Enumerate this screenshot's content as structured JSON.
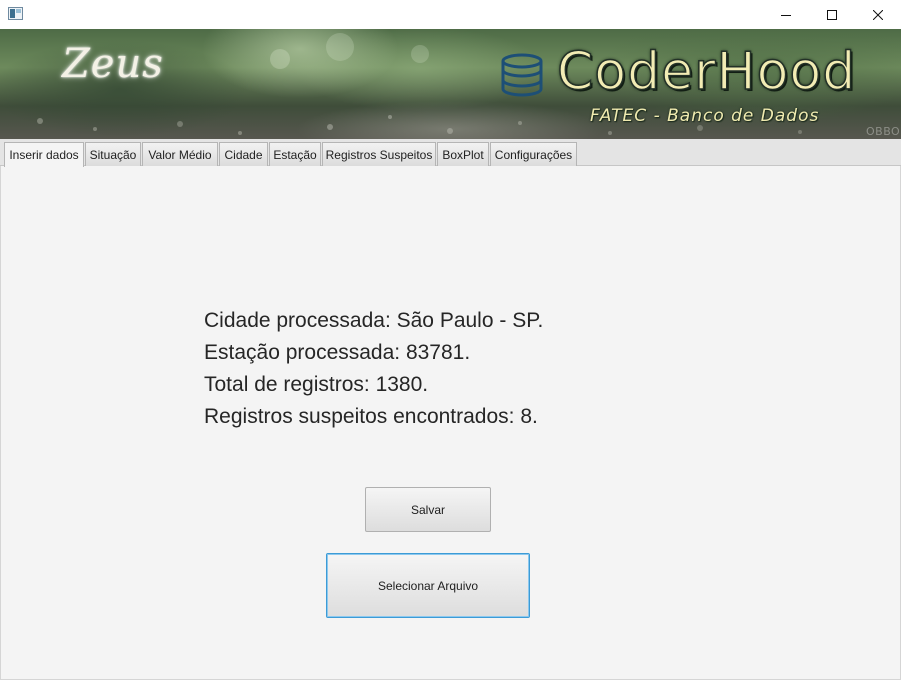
{
  "window": {
    "icons": {
      "app": "app-window-icon",
      "minimize": "minimize-icon",
      "maximize": "maximize-icon",
      "close": "close-icon"
    }
  },
  "banner": {
    "left_logo": "Zeus",
    "title": "CoderHood",
    "subtitle": "FATEC - Banco de Dados",
    "corner_text": "OBBO",
    "icon": "database-icon"
  },
  "tabs": [
    {
      "label": "Inserir dados",
      "active": true
    },
    {
      "label": "Situação",
      "active": false
    },
    {
      "label": "Valor Médio",
      "active": false
    },
    {
      "label": "Cidade",
      "active": false
    },
    {
      "label": "Estação",
      "active": false
    },
    {
      "label": "Registros Suspeitos",
      "active": false
    },
    {
      "label": "BoxPlot",
      "active": false
    },
    {
      "label": "Configurações",
      "active": false
    }
  ],
  "main": {
    "lines": [
      "Cidade processada: São Paulo - SP.",
      "Estação processada: 83781.",
      "Total de registros: 1380.",
      "Registros suspeitos encontrados: 8."
    ],
    "save_label": "Salvar",
    "select_label": "Selecionar Arquivo"
  },
  "colors": {
    "accent_focus": "#3c9bd6",
    "brand_text": "#f2ecb4",
    "content_bg": "#f4f4f4"
  }
}
